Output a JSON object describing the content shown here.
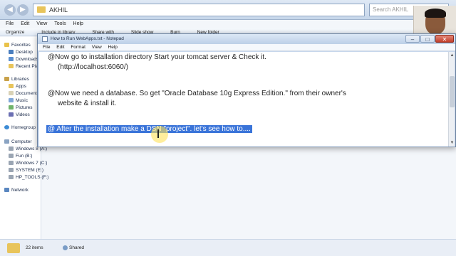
{
  "explorer": {
    "address": "AKHIL",
    "search_placeholder": "Search AKHIL",
    "menu": [
      "File",
      "Edit",
      "View",
      "Tools",
      "Help"
    ],
    "toolbar": [
      "Organize",
      "Include in library",
      "Share with",
      "Slide show",
      "Burn",
      "New folder"
    ],
    "sidebar": {
      "favorites": "Favorites",
      "desktop": "Desktop",
      "downloads": "Downloads",
      "recent": "Recent Places",
      "libraries": "Libraries",
      "apps": "Apps",
      "documents": "Documents",
      "music": "Music",
      "pictures": "Pictures",
      "videos": "Videos",
      "homegroup": "Homegroup",
      "computer": "Computer",
      "drive_c": "Windows 8 (A:)",
      "drive_b": "Fun (B:)",
      "drive_win7": "Windows 7 (C:)",
      "drive_system": "SYSTEM (E:)",
      "drive_hp": "HP_TOOLS (F:)",
      "network": "Network"
    },
    "status": {
      "count": "22 items",
      "shared": "Shared"
    },
    "colors": {
      "folder": "#e8c45b",
      "accent": "#3a74d9"
    }
  },
  "notepad": {
    "title": "How to Run WebApps.txt - Notepad",
    "menu": [
      "File",
      "Edit",
      "Format",
      "View",
      "Help"
    ],
    "lines": [
      "@Now go to installation directory Start your tomcat server & Check it.",
      "(http://localhost:6060/)",
      "@Now we need a database. So get \"Oracle Database 10g Express Edition.\" from their owner's",
      "website & install it.",
      "@  After the installation make a DSN \"project\". let's see how to...."
    ]
  }
}
